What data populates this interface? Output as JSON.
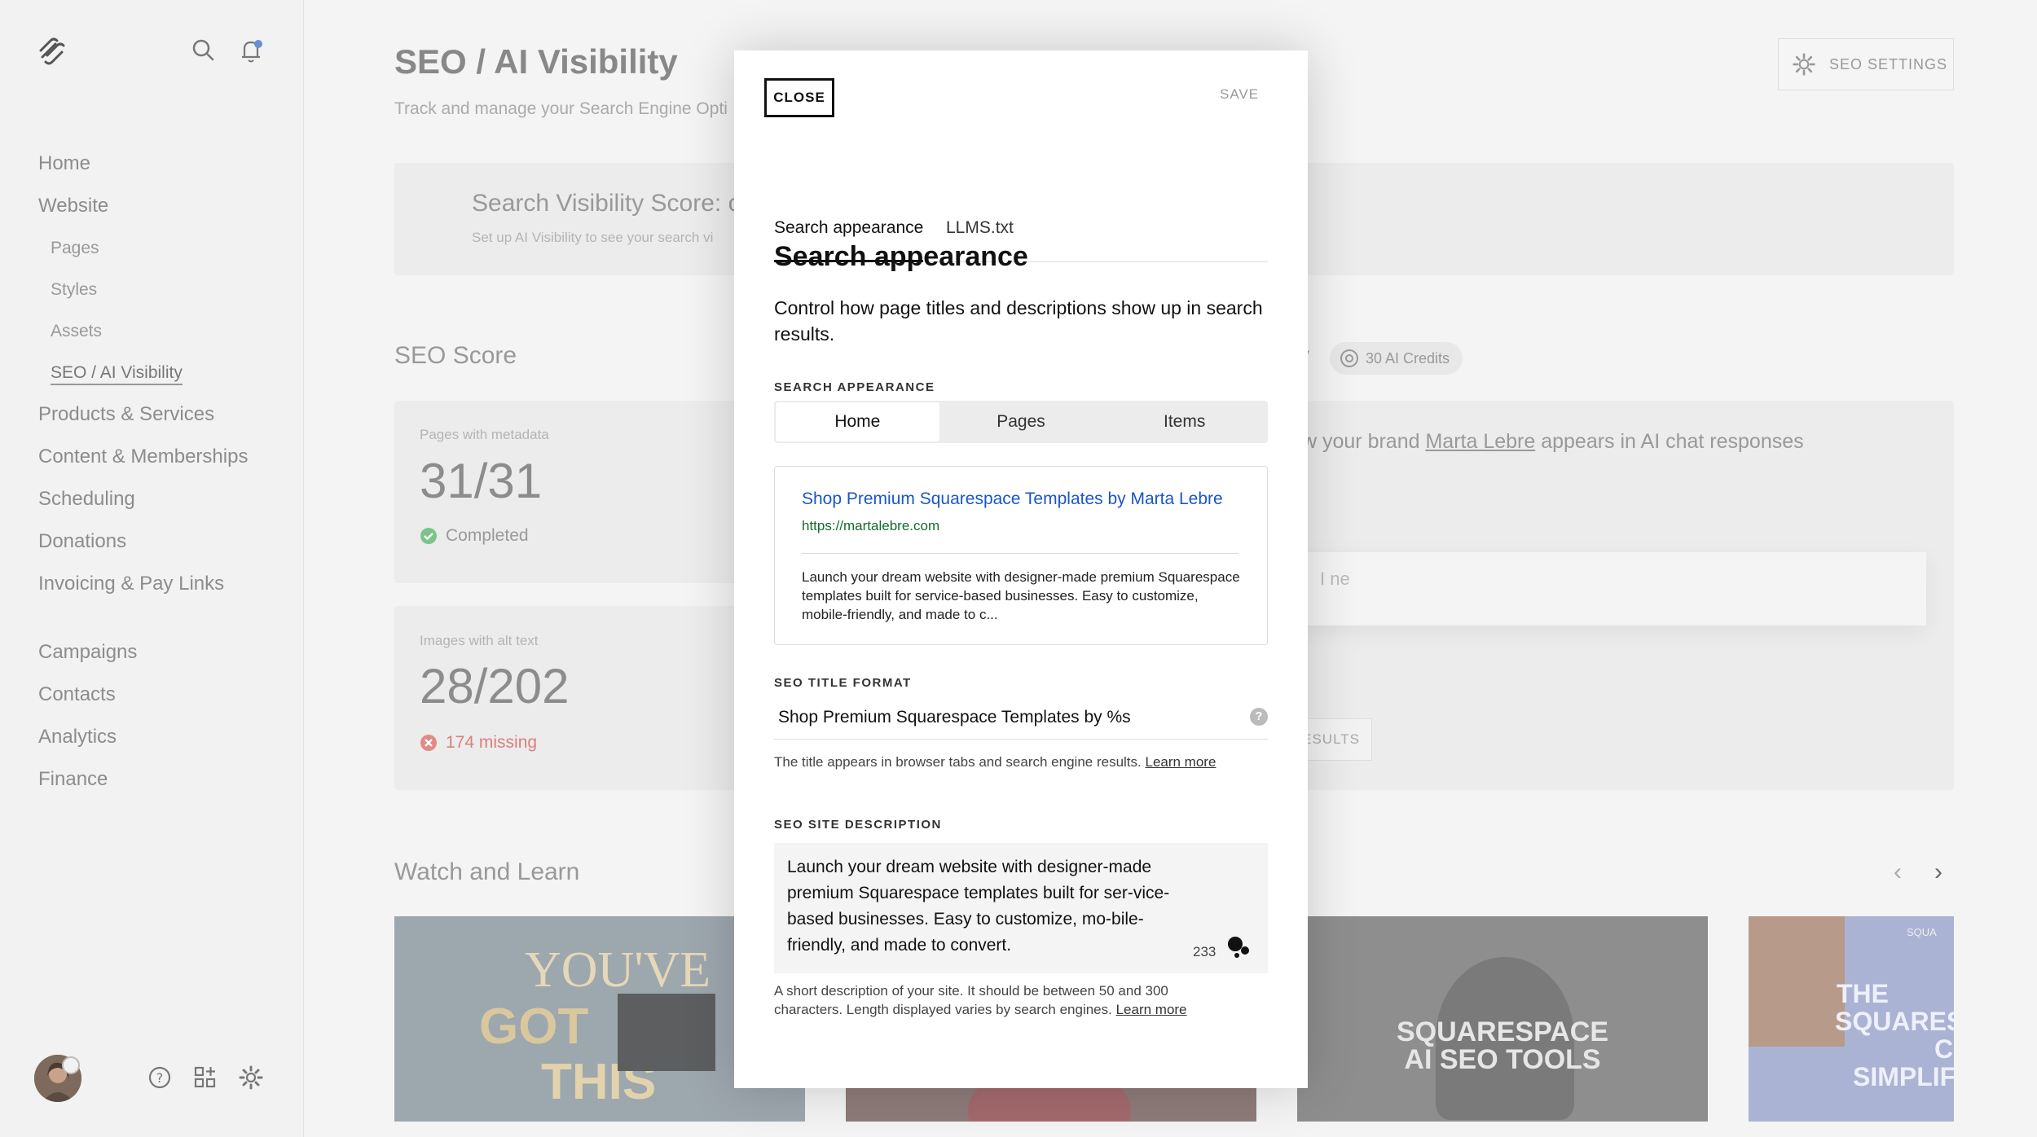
{
  "sidebar": {
    "items": [
      {
        "label": "Home"
      },
      {
        "label": "Website"
      }
    ],
    "sub_items": [
      {
        "label": "Pages"
      },
      {
        "label": "Styles"
      },
      {
        "label": "Assets"
      },
      {
        "label": "SEO / AI Visibility"
      }
    ],
    "items_2": [
      {
        "label": "Products & Services"
      },
      {
        "label": "Content & Memberships"
      },
      {
        "label": "Scheduling"
      },
      {
        "label": "Donations"
      },
      {
        "label": "Invoicing & Pay Links"
      }
    ],
    "items_3": [
      {
        "label": "Campaigns"
      },
      {
        "label": "Contacts"
      },
      {
        "label": "Analytics"
      },
      {
        "label": "Finance"
      }
    ]
  },
  "main": {
    "title": "SEO / AI Visibility",
    "subtitle": "Track and manage your Search Engine Opti",
    "seo_settings_label": "SEO SETTINGS",
    "visibility_title": "Search Visibility Score: c",
    "visibility_sub": "Set up AI Visibility to see your search vi",
    "seo_score_heading": "SEO Score",
    "metric1": {
      "label": "Pages with metadata",
      "value": "31/31",
      "status": "Completed"
    },
    "metric2": {
      "label": "Images with alt text",
      "value": "28/202",
      "status": "174 missing"
    },
    "ai_heading_fragment": "y",
    "credits": "30 AI Credits",
    "brand_pre": "w your brand ",
    "brand_name": "Marta Lebre",
    "brand_post": " appears in AI chat responses",
    "input_fragment": "I ne",
    "results_fragment": "ESULTS",
    "watch_heading": "Watch and Learn",
    "thumb1": {
      "line1": "YOU'VE",
      "line2": "GOT",
      "line3": "THIS"
    },
    "thumb3": {
      "line1": "SQUARESPACE",
      "line2": "AI SEO TOOLS"
    },
    "thumb4": {
      "line1": "THE",
      "line2": "SQUARES",
      "line3": "C",
      "line4": "SIMPLIFY",
      "badge": "SQUA"
    }
  },
  "modal": {
    "close_label": "CLOSE",
    "save_label": "SAVE",
    "tabs": [
      {
        "label": "Search appearance"
      },
      {
        "label": "LLMS.txt"
      }
    ],
    "heading": "Search appearance",
    "intro": "Control how page titles and descriptions show up in search results.",
    "appearance_label": "SEARCH APPEARANCE",
    "segments": [
      {
        "label": "Home"
      },
      {
        "label": "Pages"
      },
      {
        "label": "Items"
      }
    ],
    "preview": {
      "title": "Shop Premium Squarespace Templates by Marta Lebre",
      "url": "https://martalebre.com",
      "description": "Launch your dream website with designer-made premium Squarespace templates built for service-based businesses. Easy to customize, mobile-friendly, and made to c..."
    },
    "title_format_label": "SEO TITLE FORMAT",
    "title_format_value": "Shop Premium Squarespace Templates by %s",
    "title_hint": "The title appears in browser tabs and search engine results. ",
    "learn_more": "Learn more",
    "site_desc_label": "SEO SITE DESCRIPTION",
    "site_desc_value": "Launch your dream website with designer-made premium Squarespace templates built for ser-vice-based businesses. Easy to customize, mo-bile-friendly, and made to convert.",
    "char_count": "233",
    "desc_hint": "A short description of your site. It should be between 50 and 300 characters. Length displayed varies by search engines. "
  },
  "colors": {
    "accent_link": "#1a56c7",
    "url_green": "#146b2b",
    "success": "#5cb85c",
    "error": "#d9534f"
  }
}
